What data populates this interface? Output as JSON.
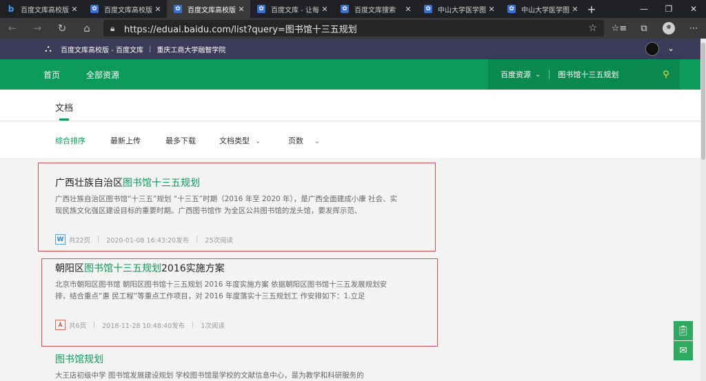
{
  "browser": {
    "tabs": [
      {
        "label": "百度文库高校版",
        "icon": "bing-icon",
        "active": false
      },
      {
        "label": "百度文库高校版",
        "icon": "paw-icon",
        "active": false
      },
      {
        "label": "百度文库高校版",
        "icon": "paw-icon",
        "active": true
      },
      {
        "label": "百度文库 - 让每",
        "icon": "paw-icon",
        "active": false
      },
      {
        "label": "百度文库搜索",
        "icon": "paw-icon",
        "active": false
      },
      {
        "label": "中山大学医学图",
        "icon": "paw-icon",
        "active": false
      },
      {
        "label": "中山大学医学图",
        "icon": "paw-icon",
        "active": false
      }
    ],
    "url": "https://eduai.baidu.com/list?query=图书馆十三五规划"
  },
  "site": {
    "brand": "百度文库高校版 - 百度文库",
    "school": "重庆工商大学融智学院"
  },
  "nav": {
    "home": "首页",
    "all": "全部资源",
    "scope": "百度资源",
    "query": "图书馆十三五规划"
  },
  "tabs": {
    "doc": "文档"
  },
  "sort": {
    "items": [
      "综合排序",
      "最新上传",
      "最多下载",
      "文档类型",
      "页数"
    ]
  },
  "results": [
    {
      "title_plain": "广西壮族自治区",
      "title_hl": "图书馆十三五规划",
      "title_tail": "",
      "desc": "广西壮族自治区图书馆“十三五”规划 “十三五”时期（2016 年至 2020 年），是广西全面建成小康 社会、实现民族文化强区建设目标的重要时期。广西图书馆作 为全区公共图书馆的龙头馆，要发挥示范、",
      "filetype": "W",
      "pages": "共22页",
      "date": "2020-01-08 16:43:20发布",
      "reads": "25次阅读"
    },
    {
      "title_plain": "朝阳区",
      "title_hl": "图书馆十三五规划",
      "title_tail": "2016实施方案",
      "desc": "北京市朝阳区图书馆 朝阳区图书馆十三五规划 2016 年度实施方案 依据朝阳区图书馆十三五发展规划安排，结合重点“惠 民工程”等重点工作项目，对 2016 年度落实十三五规划工 作安排如下：1.立足",
      "filetype": "PDF",
      "pages": "共6页",
      "date": "2018-11-28 10:48:40发布",
      "reads": "1次阅读"
    },
    {
      "title_plain": "",
      "title_hl": "图书馆规划",
      "title_tail": "",
      "desc": "大王店初级中学 图书馆发展建设规划 学校图书馆是学校的文献信息中心，是为教学和科研服务的"
    }
  ]
}
